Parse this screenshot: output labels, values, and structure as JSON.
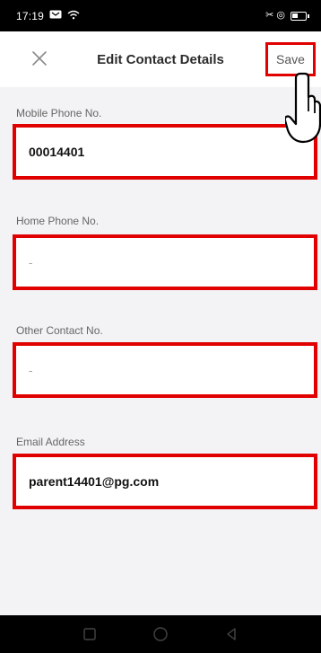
{
  "status_bar": {
    "time": "17:19",
    "right_icons": "✂ ◎"
  },
  "header": {
    "title": "Edit Contact Details",
    "save_label": "Save"
  },
  "fields": [
    {
      "label": "Mobile Phone No.",
      "value": "00014401"
    },
    {
      "label": "Home Phone No.",
      "value": "-"
    },
    {
      "label": "Other Contact No.",
      "value": "-"
    },
    {
      "label": "Email Address",
      "value": "parent14401@pg.com"
    }
  ],
  "colors": {
    "highlight": "#e00000",
    "background": "#f3f3f5",
    "status_bar": "#000000"
  },
  "icons": {
    "close": "close-icon",
    "cursor": "hand-pointer-icon",
    "nav": [
      "square-icon",
      "circle-icon",
      "back-triangle-icon"
    ]
  }
}
